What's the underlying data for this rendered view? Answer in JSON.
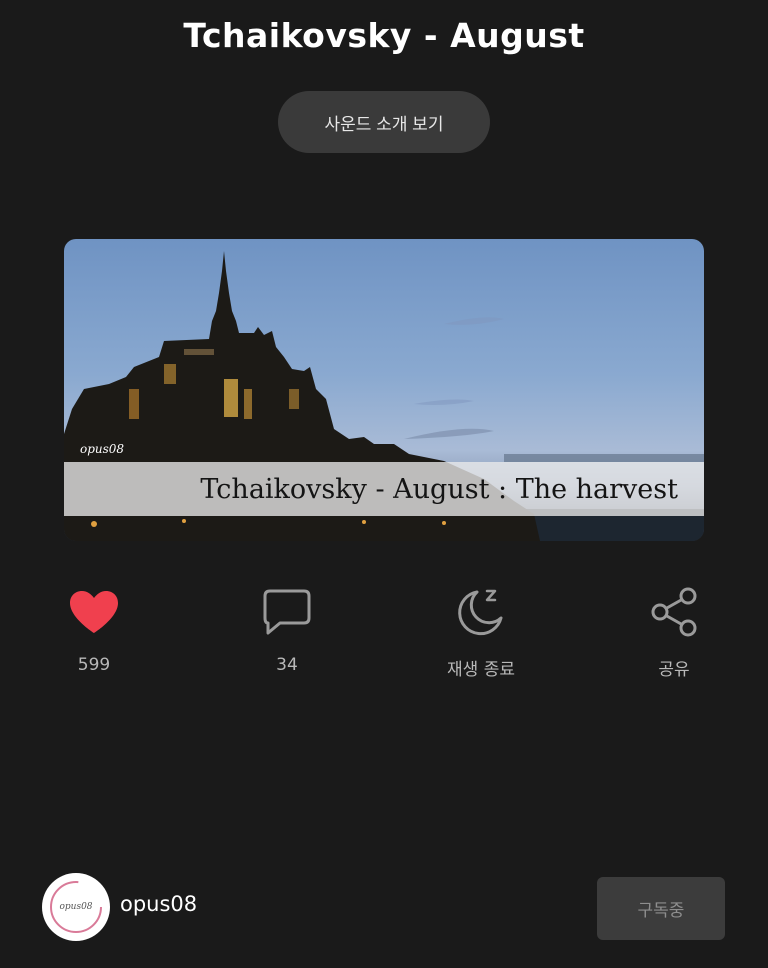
{
  "header": {
    "title": "Tchaikovsky - August",
    "intro_button_label": "사운드 소개 보기"
  },
  "artwork": {
    "watermark": "opus08",
    "caption": "Tchaikovsky - August : The harvest"
  },
  "actions": [
    {
      "name": "like",
      "icon": "heart-icon",
      "label": "599",
      "color": "#f0404e"
    },
    {
      "name": "comment",
      "icon": "speech-bubble-icon",
      "label": "34",
      "color": "#9a9a9a"
    },
    {
      "name": "sleep-timer",
      "icon": "moon-zzz-icon",
      "label": "재생 종료",
      "color": "#9a9a9a"
    },
    {
      "name": "share",
      "icon": "share-icon",
      "label": "공유",
      "color": "#9a9a9a"
    }
  ],
  "profile": {
    "avatar_text": "opus08",
    "username": "opus08",
    "subscribe_label": "구독중"
  },
  "colors": {
    "background": "#1a1a1a",
    "heart": "#f0404e",
    "button_bg": "#3a3a3a"
  }
}
